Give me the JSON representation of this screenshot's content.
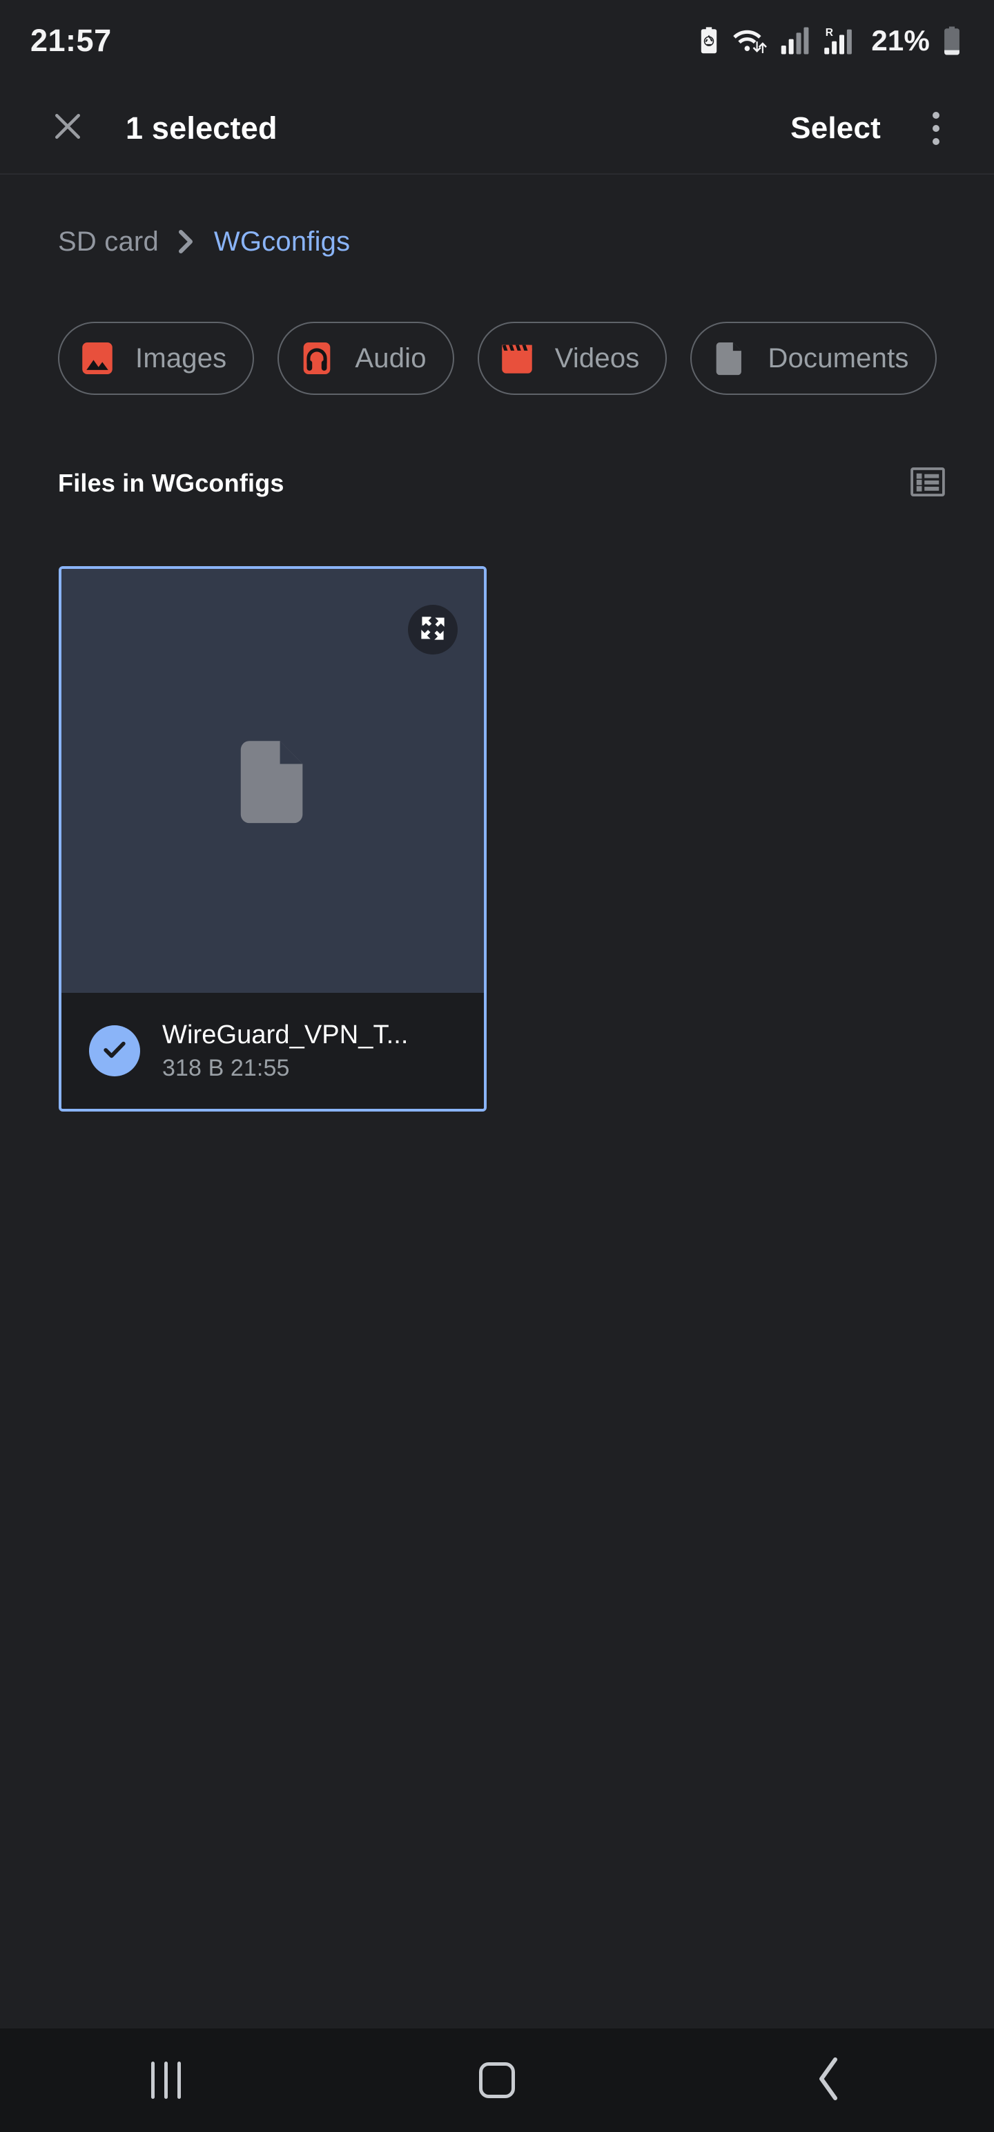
{
  "status_bar": {
    "time": "21:57",
    "battery_percent": "21%",
    "icons": [
      "power-saving-battery-icon",
      "wifi-data-transfer-icon",
      "signal-bars-icon",
      "roaming-signal-bars-icon",
      "battery-icon"
    ]
  },
  "app_bar": {
    "close_label": "close-icon",
    "title": "1 selected",
    "select_label": "Select",
    "overflow_label": "more-options-icon"
  },
  "breadcrumb": {
    "root": "SD card",
    "separator": "chevron-right-icon",
    "current": "WGconfigs"
  },
  "filter_chips": [
    {
      "label": "Images",
      "icon": "image-icon",
      "color": "#e8503c"
    },
    {
      "label": "Audio",
      "icon": "headphones-icon",
      "color": "#e8503c"
    },
    {
      "label": "Videos",
      "icon": "clapperboard-icon",
      "color": "#e8503c"
    },
    {
      "label": "Documents",
      "icon": "document-icon",
      "color": "#85888d"
    }
  ],
  "section": {
    "title": "Files in WGconfigs",
    "view_toggle": "list-view-icon"
  },
  "file_card": {
    "name": "WireGuard_VPN_T...",
    "size": "318 B",
    "time": "21:55",
    "meta": "318 B  21:55",
    "selected": true,
    "thumb_icon": "document-icon",
    "expand_icon": "expand-fullscreen-icon",
    "check_icon": "check-icon"
  },
  "nav_bar": {
    "recents": "recents-icon",
    "home": "home-icon",
    "back": "back-icon"
  },
  "colors": {
    "background": "#1f2023",
    "accent_blue": "#8ab4f8",
    "chip_red": "#e8503c",
    "secondary_text": "#9aa0a6"
  }
}
